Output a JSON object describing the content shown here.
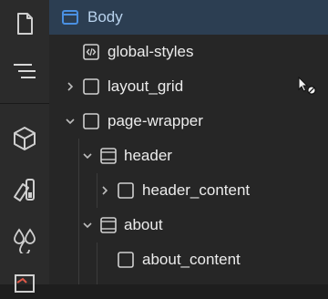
{
  "sidebar_icons": [
    {
      "name": "page-icon"
    },
    {
      "name": "navigator-icon"
    },
    {
      "name": "components-icon"
    },
    {
      "name": "style-manager-icon"
    },
    {
      "name": "color-swatches-icon"
    },
    {
      "name": "assets-icon"
    }
  ],
  "tree": {
    "items": [
      {
        "label": "Body",
        "icon": "body-frame-icon",
        "state": "selected"
      },
      {
        "label": "global-styles",
        "icon": "code-embed-icon"
      },
      {
        "label": "layout_grid",
        "icon": "div-block-icon",
        "chevron": "collapsed"
      },
      {
        "label": "page-wrapper",
        "icon": "div-block-icon",
        "chevron": "expanded"
      },
      {
        "label": "header",
        "icon": "section-icon",
        "chevron": "expanded"
      },
      {
        "label": "header_content",
        "icon": "div-block-icon",
        "chevron": "collapsed"
      },
      {
        "label": "about",
        "icon": "section-icon",
        "chevron": "expanded"
      },
      {
        "label": "about_content",
        "icon": "div-block-icon"
      }
    ]
  },
  "colors": {
    "selected_bg": "#2c3e52",
    "selected_text": "#b9d3ee",
    "accent": "#4a90e2",
    "panel_bg": "#262626",
    "rail_bg": "#2b2b2b"
  }
}
